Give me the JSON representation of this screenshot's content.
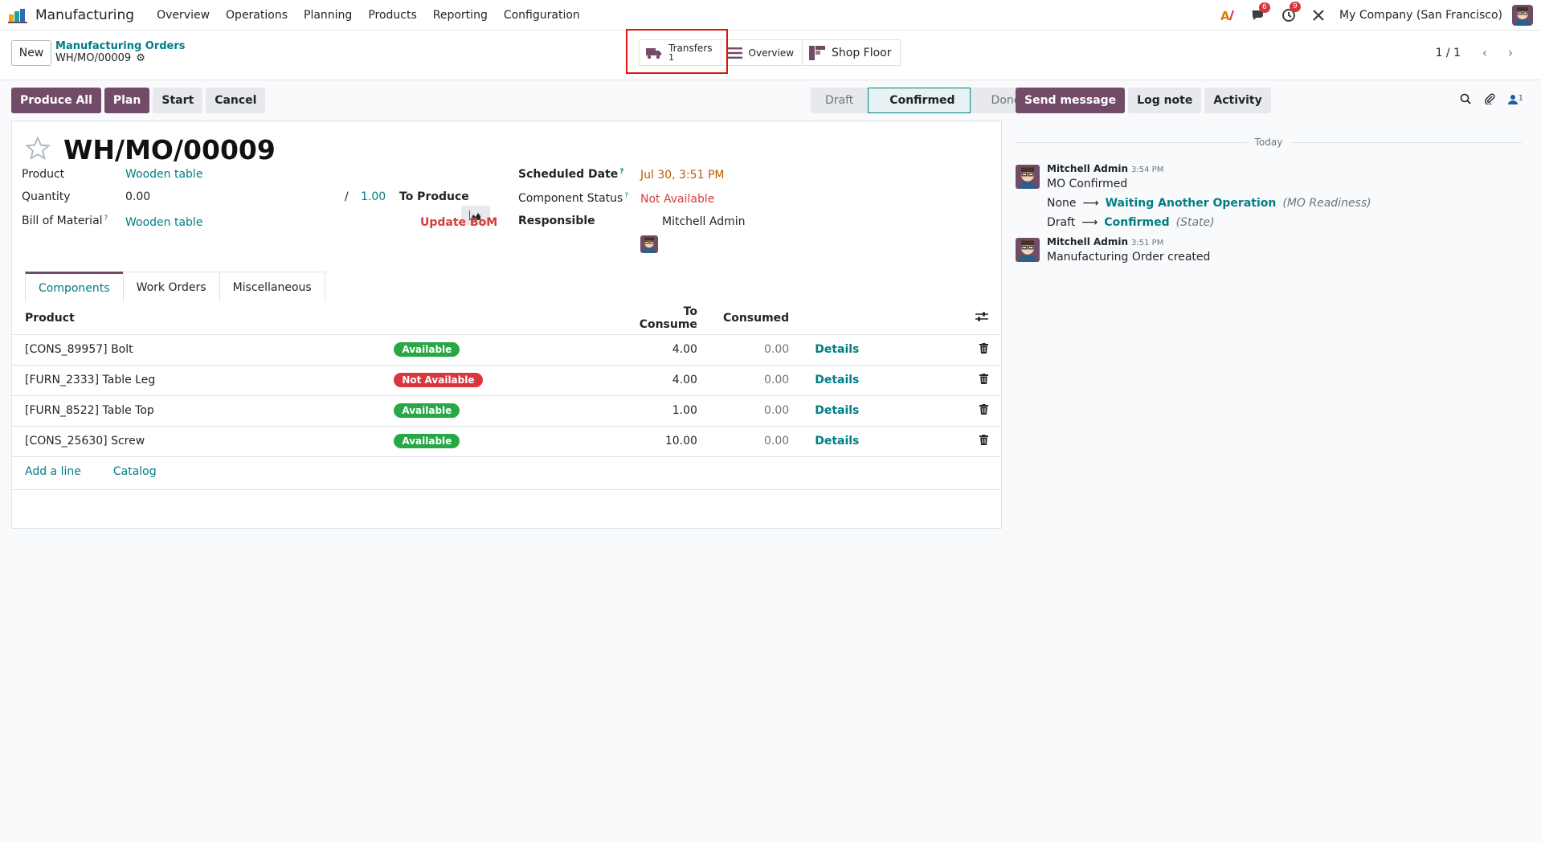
{
  "navbar": {
    "app_name": "Manufacturing",
    "menu": [
      "Overview",
      "Operations",
      "Planning",
      "Products",
      "Reporting",
      "Configuration"
    ],
    "messages_badge": "6",
    "activities_badge": "9",
    "company": "My Company (San Francisco)",
    "icons": [
      "ai-icon",
      "messages-icon",
      "activities-icon",
      "debug-tools-icon"
    ]
  },
  "control": {
    "new_label": "New",
    "breadcrumb_parent": "Manufacturing Orders",
    "breadcrumb_current": "WH/MO/00009",
    "smart_buttons": {
      "transfers_label": "Transfers",
      "transfers_count": "1",
      "overview_label": "Overview",
      "shop_floor_label": "Shop Floor"
    },
    "pager": "1 / 1"
  },
  "actions": {
    "produce_all": "Produce All",
    "plan": "Plan",
    "start": "Start",
    "cancel": "Cancel"
  },
  "statusbar": {
    "stages": [
      "Draft",
      "Confirmed",
      "Done"
    ],
    "current": "Confirmed"
  },
  "form": {
    "title": "WH/MO/00009",
    "product_label": "Product",
    "product_value": "Wooden table",
    "quantity_label": "Quantity",
    "quantity_value": "0.00",
    "quantity_sep": "/",
    "quantity_total": "1.00",
    "to_produce_label": "To Produce",
    "bom_label": "Bill of Material",
    "bom_value": "Wooden table",
    "update_bom": "Update BoM",
    "scheduled_label": "Scheduled Date",
    "scheduled_value": "Jul 30, 3:51 PM",
    "component_status_label": "Component Status",
    "component_status_value": "Not Available",
    "responsible_label": "Responsible",
    "responsible_value": "Mitchell Admin",
    "help_mark": "?"
  },
  "tabs": [
    "Components",
    "Work Orders",
    "Miscellaneous"
  ],
  "components": {
    "headers": {
      "product": "Product",
      "to_consume": "To Consume",
      "consumed": "Consumed"
    },
    "rows": [
      {
        "product": "[CONS_89957] Bolt",
        "status": "Available",
        "to_consume": "4.00",
        "consumed": "0.00",
        "details": "Details"
      },
      {
        "product": "[FURN_2333] Table Leg",
        "status": "Not Available",
        "to_consume": "4.00",
        "consumed": "0.00",
        "details": "Details"
      },
      {
        "product": "[FURN_8522] Table Top",
        "status": "Available",
        "to_consume": "1.00",
        "consumed": "0.00",
        "details": "Details"
      },
      {
        "product": "[CONS_25630] Screw",
        "status": "Available",
        "to_consume": "10.00",
        "consumed": "0.00",
        "details": "Details"
      }
    ],
    "add_line": "Add a line",
    "catalog": "Catalog"
  },
  "chatter": {
    "send_message": "Send message",
    "log_note": "Log note",
    "activity": "Activity",
    "followers_count": "1",
    "today": "Today",
    "messages": [
      {
        "author": "Mitchell Admin",
        "time": "3:54 PM",
        "text": "MO Confirmed",
        "tracking": [
          {
            "old": "None",
            "new": "Waiting Another Operation",
            "field": "(MO Readiness)"
          },
          {
            "old": "Draft",
            "new": "Confirmed",
            "field": "(State)"
          }
        ]
      },
      {
        "author": "Mitchell Admin",
        "time": "3:51 PM",
        "text": "Manufacturing Order created"
      }
    ]
  },
  "colors": {
    "primary": "#714b67",
    "link": "#017e84",
    "danger": "#d9363e",
    "success": "#28a745",
    "highlight": "#e3120b"
  }
}
